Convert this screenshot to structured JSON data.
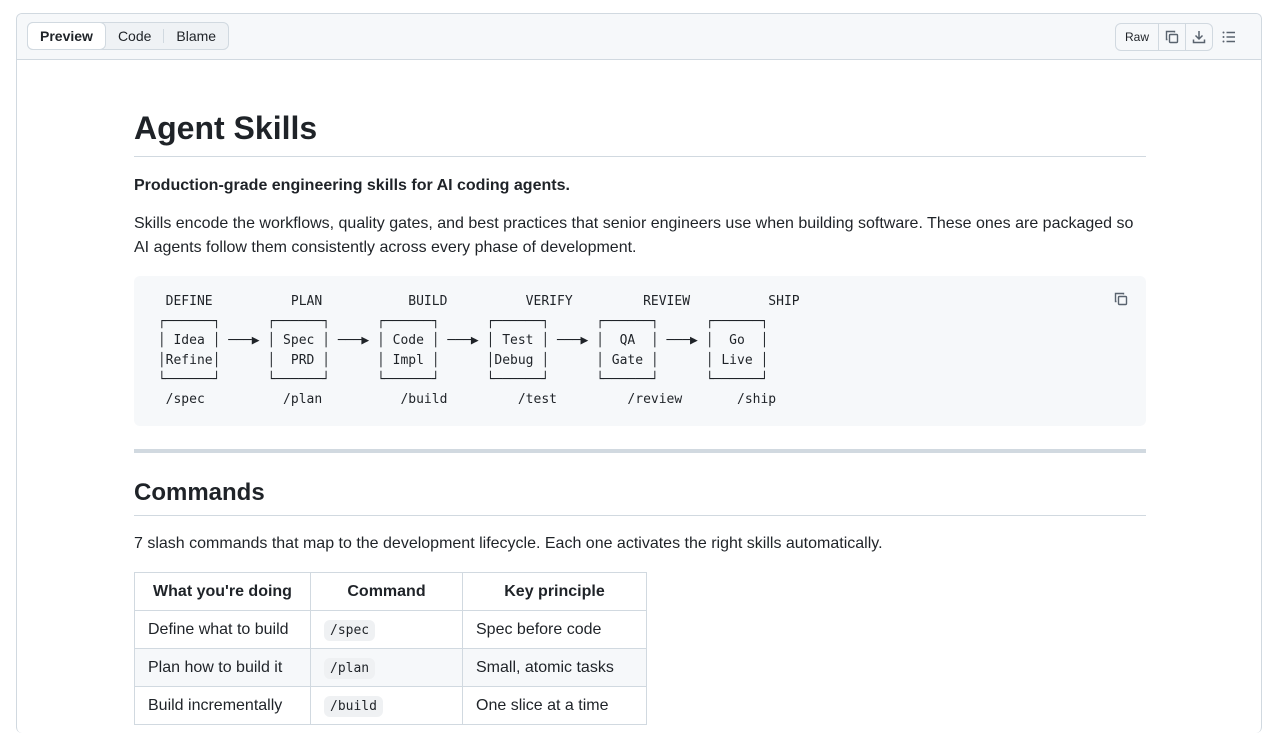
{
  "toolbar": {
    "tabs": [
      {
        "label": "Preview",
        "active": true
      },
      {
        "label": "Code",
        "active": false
      },
      {
        "label": "Blame",
        "active": false
      }
    ],
    "raw_label": "Raw",
    "icons": [
      "copy-icon",
      "download-icon",
      "list-unordered-icon"
    ]
  },
  "readme": {
    "title": "Agent Skills",
    "tagline": "Production-grade engineering skills for AI coding agents.",
    "intro": "Skills encode the workflows, quality gates, and best practices that senior engineers use when building software. These ones are packaged so AI agents follow them consistently across every phase of development.",
    "diagram": "  DEFINE          PLAN           BUILD          VERIFY         REVIEW          SHIP\n ┌──────┐      ┌──────┐      ┌──────┐      ┌──────┐      ┌──────┐      ┌──────┐\n │ Idea │ ───▶ │ Spec │ ───▶ │ Code │ ───▶ │ Test │ ───▶ │  QA  │ ───▶ │  Go  │\n │Refine│      │  PRD │      │ Impl │      │Debug │      │ Gate │      │ Live │\n └──────┘      └──────┘      └──────┘      └──────┘      └──────┘      └──────┘\n  /spec          /plan          /build         /test         /review       /ship",
    "commands_heading": "Commands",
    "commands_intro": "7 slash commands that map to the development lifecycle. Each one activates the right skills automatically.",
    "table": {
      "headers": [
        "What you're doing",
        "Command",
        "Key principle"
      ],
      "rows": [
        {
          "doing": "Define what to build",
          "command": "/spec",
          "principle": "Spec before code"
        },
        {
          "doing": "Plan how to build it",
          "command": "/plan",
          "principle": "Small, atomic tasks"
        },
        {
          "doing": "Build incrementally",
          "command": "/build",
          "principle": "One slice at a time"
        }
      ]
    }
  }
}
